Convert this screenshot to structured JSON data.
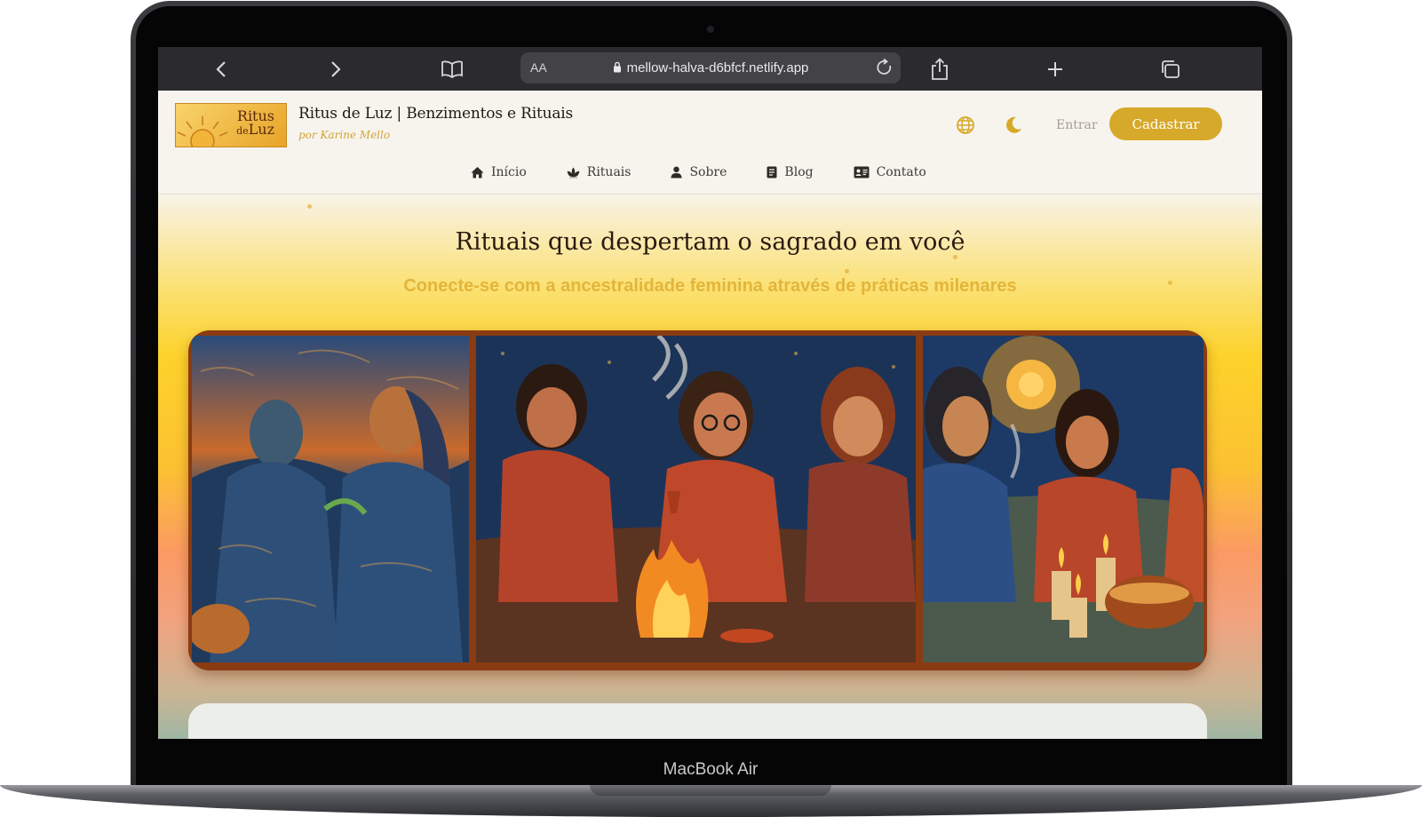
{
  "device": {
    "label": "MacBook Air"
  },
  "browser": {
    "aa_label": "AA",
    "url": "mellow-halva-d6bfcf.netlify.app",
    "icons": [
      "chevron-left-icon",
      "chevron-right-icon",
      "book-icon",
      "lock-icon",
      "reload-icon",
      "share-icon",
      "plus-icon",
      "tabs-icon"
    ]
  },
  "site": {
    "logo": {
      "line1": "Ritus",
      "line2_small": "de",
      "line2": "Luz"
    },
    "title": "Ritus de Luz | Benzimentos e Rituais",
    "author": "por Karine Mello",
    "header_actions": {
      "language_icon": "globe-icon",
      "theme_icon": "moon-icon",
      "login_label": "Entrar",
      "signup_label": "Cadastrar"
    },
    "nav": [
      {
        "label": "Início",
        "icon": "home-icon"
      },
      {
        "label": "Rituais",
        "icon": "lotus-icon"
      },
      {
        "label": "Sobre",
        "icon": "user-icon"
      },
      {
        "label": "Blog",
        "icon": "document-icon"
      },
      {
        "label": "Contato",
        "icon": "contact-card-icon"
      }
    ]
  },
  "hero": {
    "title": "Rituais que despertam o sagrado em você",
    "subtitle": "Conecte-se com a ancestralidade feminina através de práticas milenares",
    "gallery": [
      {
        "description": "women-praying-with-herbs-painting"
      },
      {
        "description": "women-around-fire-painting"
      },
      {
        "description": "women-with-candles-under-sun-painting"
      }
    ]
  },
  "colors": {
    "accent": "#d7a92a",
    "gallery_frame": "#8a3b12",
    "subtitle": "#e3b53a"
  }
}
